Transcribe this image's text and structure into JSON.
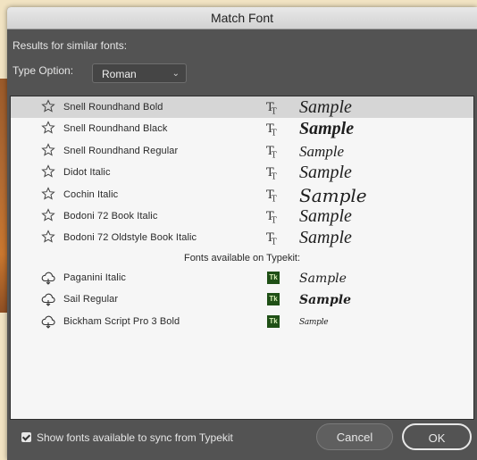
{
  "dialog": {
    "title": "Match Font"
  },
  "results_label": "Results for similar fonts:",
  "type_option": {
    "label": "Type Option:",
    "value": "Roman"
  },
  "fonts": [
    {
      "name": "Snell Roundhand Bold",
      "sample": "Sample",
      "selected": true
    },
    {
      "name": "Snell Roundhand Black",
      "sample": "Sample",
      "selected": false
    },
    {
      "name": "Snell Roundhand Regular",
      "sample": "Sample",
      "selected": false
    },
    {
      "name": "Didot Italic",
      "sample": "Sample",
      "selected": false
    },
    {
      "name": "Cochin Italic",
      "sample": "Sample",
      "selected": false
    },
    {
      "name": "Bodoni 72 Book Italic",
      "sample": "Sample",
      "selected": false
    },
    {
      "name": "Bodoni 72 Oldstyle Book Italic",
      "sample": "Sample",
      "selected": false
    }
  ],
  "typekit_header": "Fonts available on Typekit:",
  "typekit_fonts": [
    {
      "name": "Paganini Italic",
      "sample": "Sample",
      "badge": "Tk"
    },
    {
      "name": "Sail Regular",
      "sample": "Sample",
      "badge": "Tk"
    },
    {
      "name": "Bickham Script Pro 3 Bold",
      "sample": "Sample",
      "badge": "Tk"
    }
  ],
  "footer": {
    "sync_label": "Show fonts available to sync from Typekit",
    "sync_checked": true,
    "cancel_label": "Cancel",
    "ok_label": "OK"
  },
  "colors": {
    "dialog_bg": "#535353",
    "list_bg": "#f6f6f6",
    "selected_row": "#d6d6d6",
    "typekit_badge": "#1f4f16"
  }
}
